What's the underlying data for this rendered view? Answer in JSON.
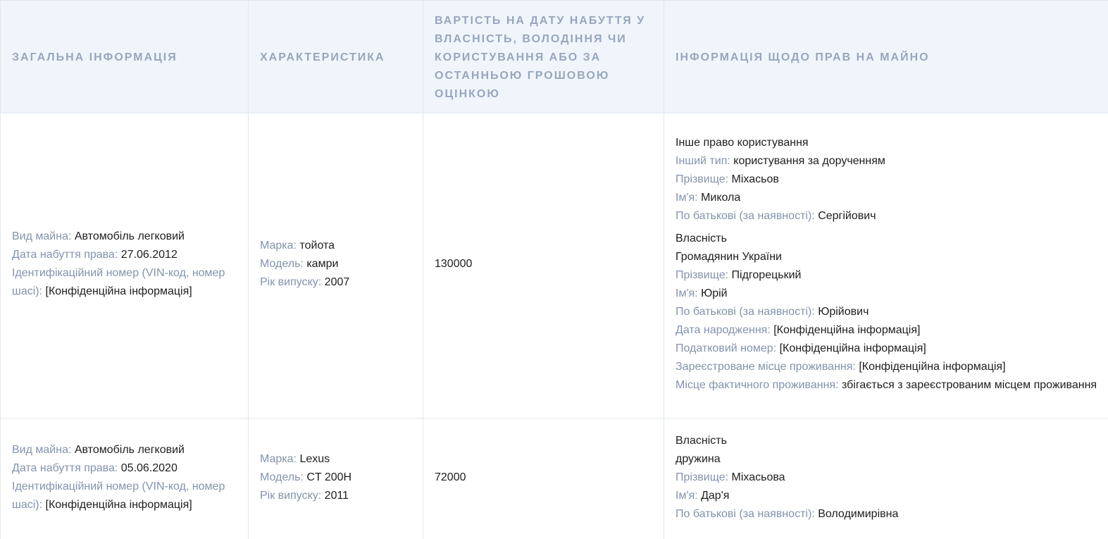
{
  "headers": {
    "general": "Загальна інформація",
    "characteristics": "Характеристика",
    "value": "Вартість на дату набуття у власність, володіння чи користування або за останньою грошовою оцінкою",
    "rights": "Інформація щодо прав на майно"
  },
  "rows": [
    {
      "general": {
        "type_label": "Вид майна:",
        "type_value": "Автомобіль легковий",
        "date_label": "Дата набуття права:",
        "date_value": "27.06.2012",
        "vin_label": "Ідентифікаційний номер (VIN-код, номер шасі):",
        "vin_value": "[Конфіденційна інформація]"
      },
      "characteristics": {
        "brand_label": "Марка:",
        "brand_value": "тойота",
        "model_label": "Модель:",
        "model_value": "камри",
        "year_label": "Рік випуску:",
        "year_value": "2007"
      },
      "value": "130000",
      "rights": [
        {
          "title": "Інше право користування",
          "other_type_label": "Інший тип:",
          "other_type_value": "користування за дорученням",
          "surname_label": "Прізвище:",
          "surname_value": "Міхасьов",
          "name_label": "Ім'я:",
          "name_value": "Микола",
          "patronymic_label": "По батькові (за наявності):",
          "patronymic_value": "Сергійович"
        },
        {
          "title": "Власність",
          "subtitle": "Громадянин України",
          "surname_label": "Прізвище:",
          "surname_value": "Підгорецький",
          "name_label": "Ім'я:",
          "name_value": "Юрій",
          "patronymic_label": "По батькові (за наявності):",
          "patronymic_value": "Юрійович",
          "birth_label": "Дата народження:",
          "birth_value": "[Конфіденційна інформація]",
          "tax_label": "Податковий номер:",
          "tax_value": "[Конфіденційна інформація]",
          "registered_label": "Зареєстроване місце проживання:",
          "registered_value": "[Конфіденційна інформація]",
          "actual_label": "Місце фактичного проживання:",
          "actual_value": "збігається з зареєстрованим місцем проживання"
        }
      ]
    },
    {
      "general": {
        "type_label": "Вид майна:",
        "type_value": "Автомобіль легковий",
        "date_label": "Дата набуття права:",
        "date_value": "05.06.2020",
        "vin_label": "Ідентифікаційний номер (VIN-код, номер шасі):",
        "vin_value": "[Конфіденційна інформація]"
      },
      "characteristics": {
        "brand_label": "Марка:",
        "brand_value": "Lexus",
        "model_label": "Модель:",
        "model_value": "CT 200H",
        "year_label": "Рік випуску:",
        "year_value": "2011"
      },
      "value": "72000",
      "rights": [
        {
          "title": "Власність",
          "subtitle": "дружина",
          "surname_label": "Прізвище:",
          "surname_value": "Міхасьова",
          "name_label": "Ім'я:",
          "name_value": "Дар'я",
          "patronymic_label": "По батькові (за наявності):",
          "patronymic_value": "Володимирівна"
        }
      ]
    }
  ]
}
